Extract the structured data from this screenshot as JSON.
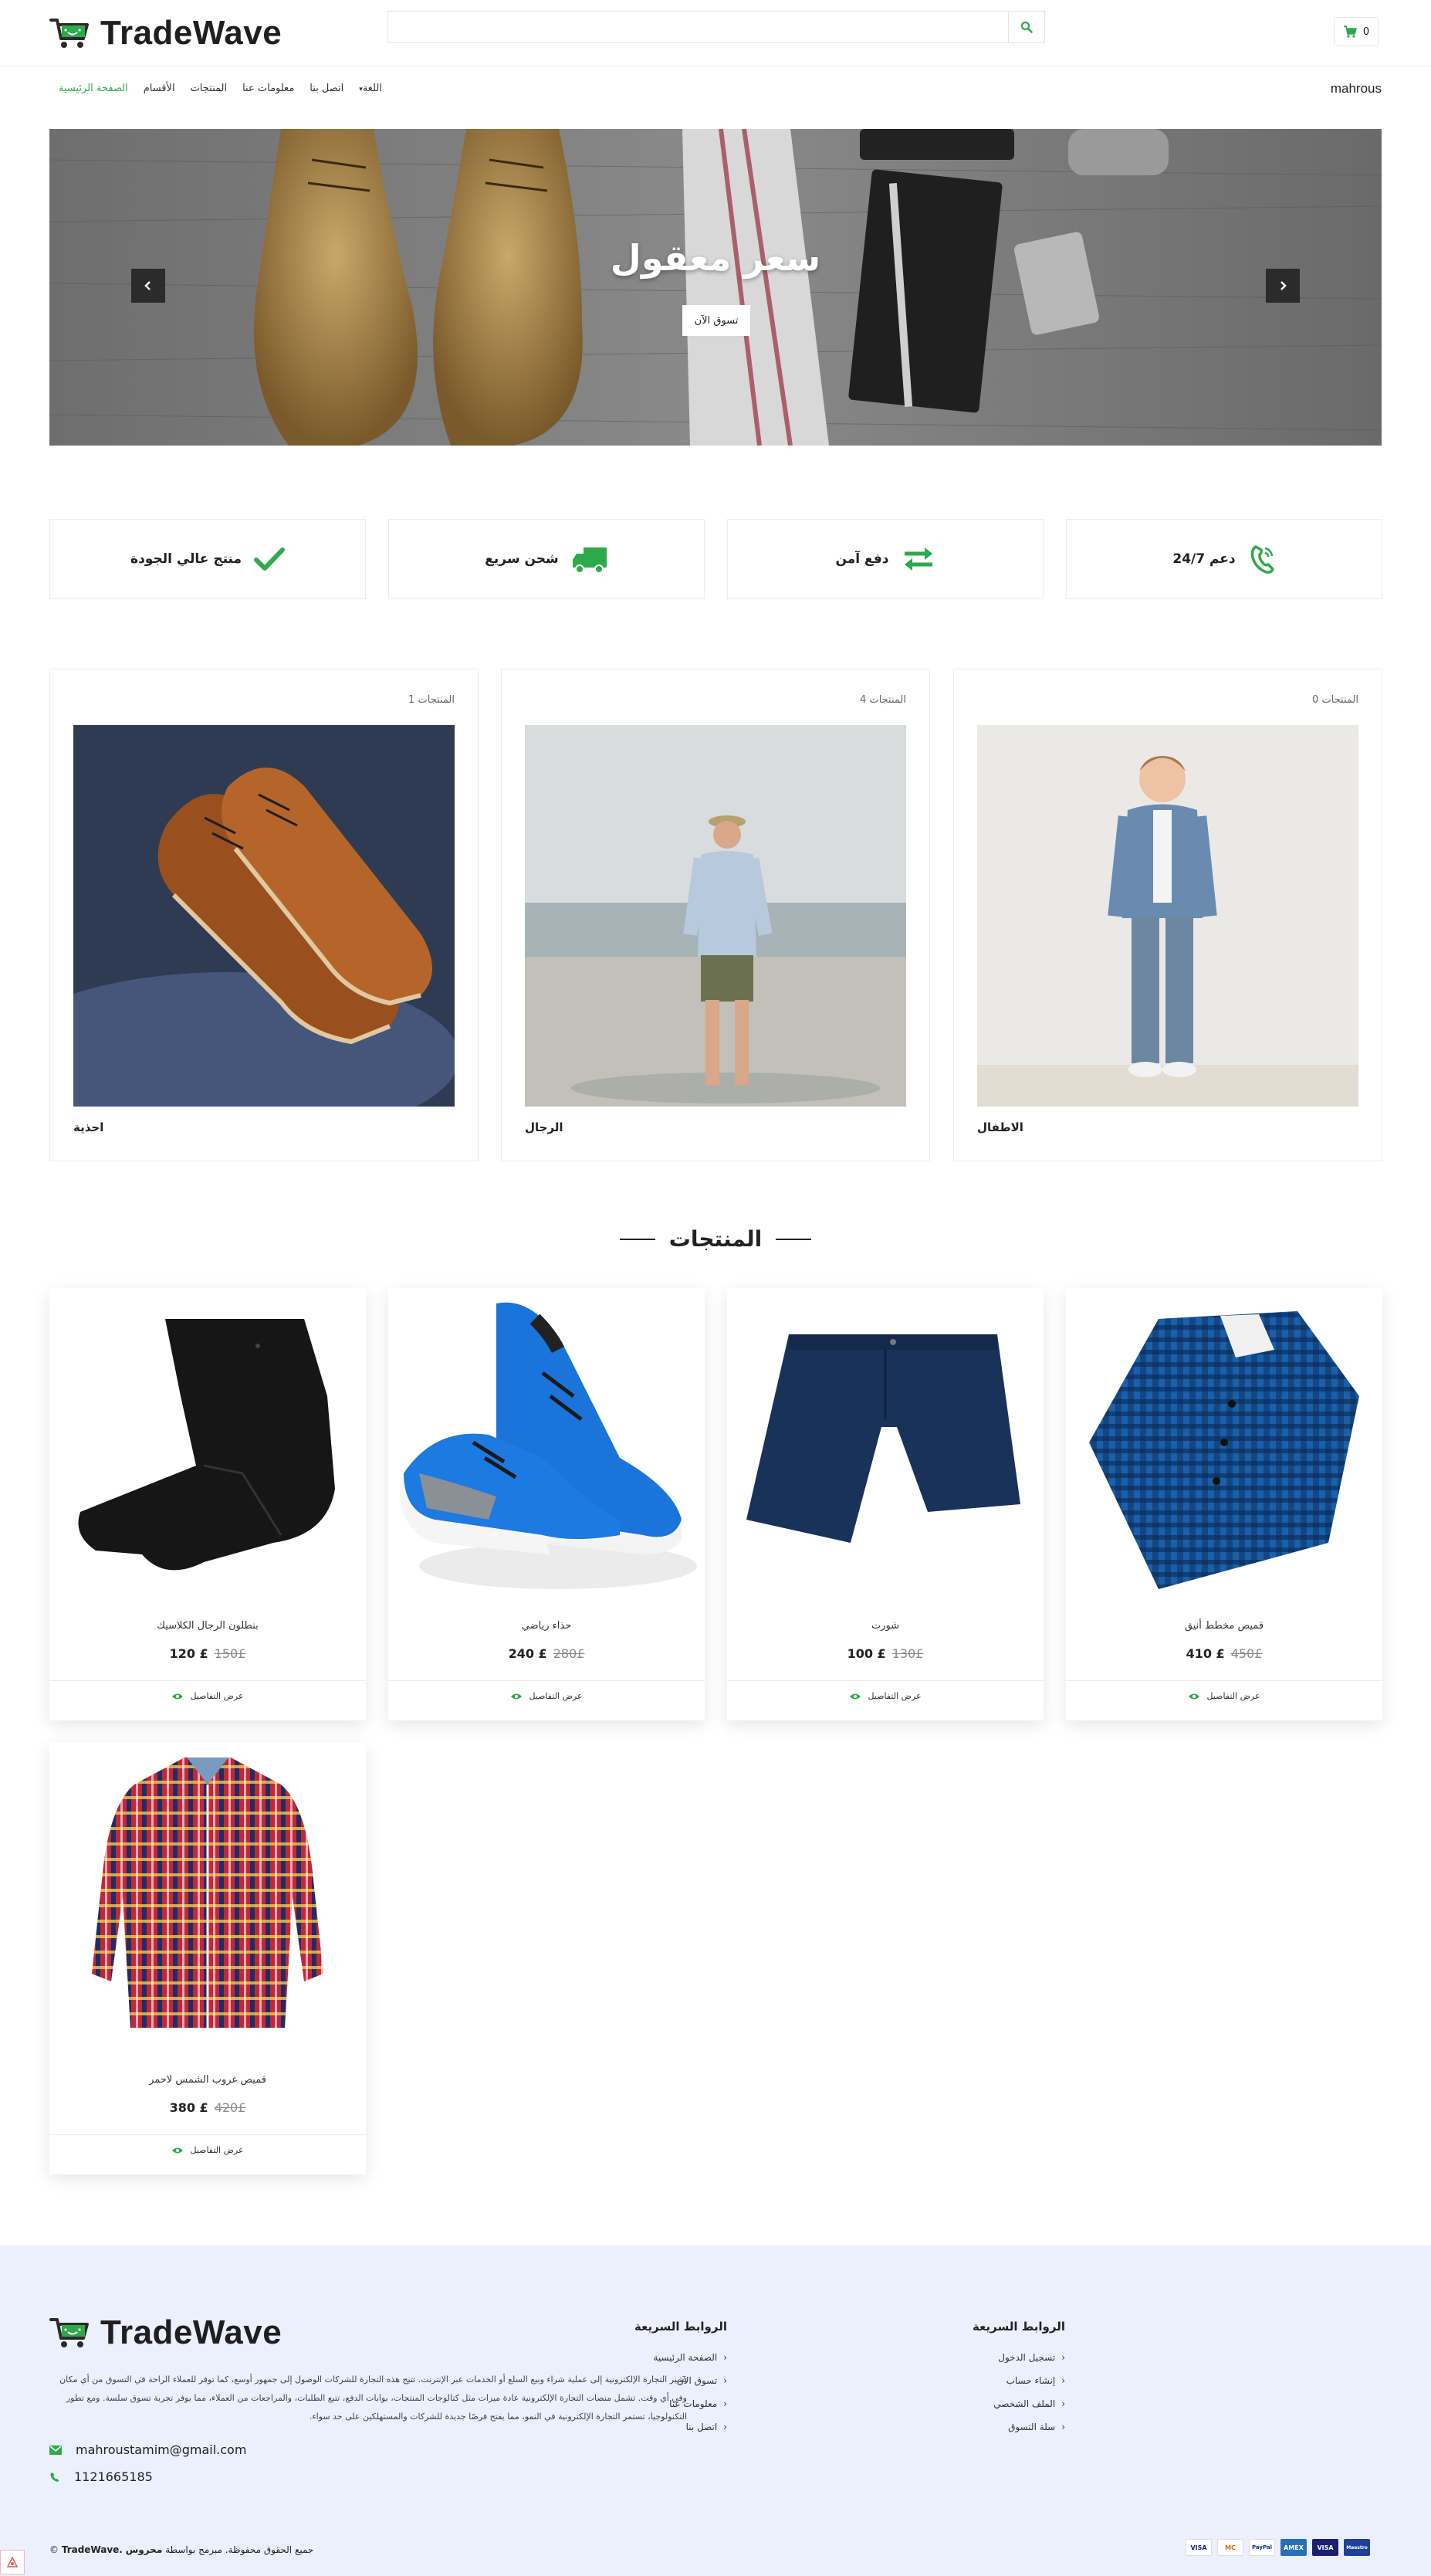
{
  "brand": {
    "name": "TradeWave",
    "accent_color": "#2eaa4a"
  },
  "search": {
    "placeholder": "",
    "button_icon": "search-icon"
  },
  "cart": {
    "count": "0"
  },
  "nav": {
    "items": [
      {
        "label": "الصفحة الرئيسية",
        "active": true
      },
      {
        "label": "الأقسام"
      },
      {
        "label": "المنتجات"
      },
      {
        "label": "معلومات عنا"
      },
      {
        "label": "اتصل بنا"
      },
      {
        "label": "اللغة"
      }
    ],
    "user": "mahrous"
  },
  "hero": {
    "title": "سعر معقول",
    "button": "تسوق الآن"
  },
  "features": [
    {
      "label": "منتج عالي الجودة",
      "icon": "check-icon"
    },
    {
      "label": "شحن سريع",
      "icon": "truck-icon"
    },
    {
      "label": "دفع آمن",
      "icon": "exchange-icon"
    },
    {
      "label": "دعم 24/7",
      "icon": "phone-icon"
    }
  ],
  "categories": [
    {
      "name": "احذية",
      "count": "المنتجات 1"
    },
    {
      "name": "الرجال",
      "count": "المنتجات 4"
    },
    {
      "name": "الاطفال",
      "count": "المنتجات 0"
    }
  ],
  "products_title": "المنتجات",
  "products": [
    {
      "name": "بنطلون الرجال الكلاسيك",
      "price": "120 £",
      "old_price": "150£",
      "view": "عرض التفاصيل"
    },
    {
      "name": "حذاء رياضي",
      "price": "240 £",
      "old_price": "280£",
      "view": "عرض التفاصيل"
    },
    {
      "name": "شورت",
      "price": "100 £",
      "old_price": "130£",
      "view": "عرض التفاصيل"
    },
    {
      "name": "قميص مخطط أنيق",
      "price": "410 £",
      "old_price": "450£",
      "view": "عرض التفاصيل"
    },
    {
      "name": "قميص غروب الشمس لاحمر",
      "price": "380 £",
      "old_price": "420£",
      "view": "عرض التفاصيل"
    }
  ],
  "footer": {
    "description": "تشير التجارة الإلكترونية إلى عملية شراء وبيع السلع أو الخدمات عبر الإنترنت. تتيح هذه التجارة للشركات الوصول إلى جمهور أوسع، كما توفر للعملاء الراحة في التسوق من أي مكان وفي أي وقت. تشمل منصات التجارة الإلكترونية عادة ميزات مثل كتالوجات المنتجات، بوابات الدفع، تتبع الطلبات، والمراجعات من العملاء، مما يوفر تجربة تسوق سلسة. ومع تطور التكنولوجيا، تستمر التجارة الإلكترونية في النمو، مما يفتح فرصًا جديدة للشركات والمستهلكين على حد سواء.",
    "email": "mahroustamim@gmail.com",
    "phone": "1121665185",
    "col1": {
      "title": "الروابط السريعة",
      "links": [
        "الصفحة الرئيسية",
        "تسوق الآن",
        "معلومات عنا",
        "اتصل بنا"
      ]
    },
    "col2": {
      "title": "الروابط السريعة",
      "links": [
        "تسجيل الدخول",
        "إنشاء حساب",
        "الملف الشخصي",
        "سلة التسوق"
      ]
    },
    "copyright_prefix": "© ",
    "copyright_brand": "TradeWave.",
    "copyright_text": "جميع الحقوق محفوظة. مبرمج بواسطة",
    "copyright_author": "محروس",
    "payments": [
      "VISA",
      "MC",
      "PayPal",
      "AMEX",
      "VISA",
      "Maestro"
    ]
  }
}
